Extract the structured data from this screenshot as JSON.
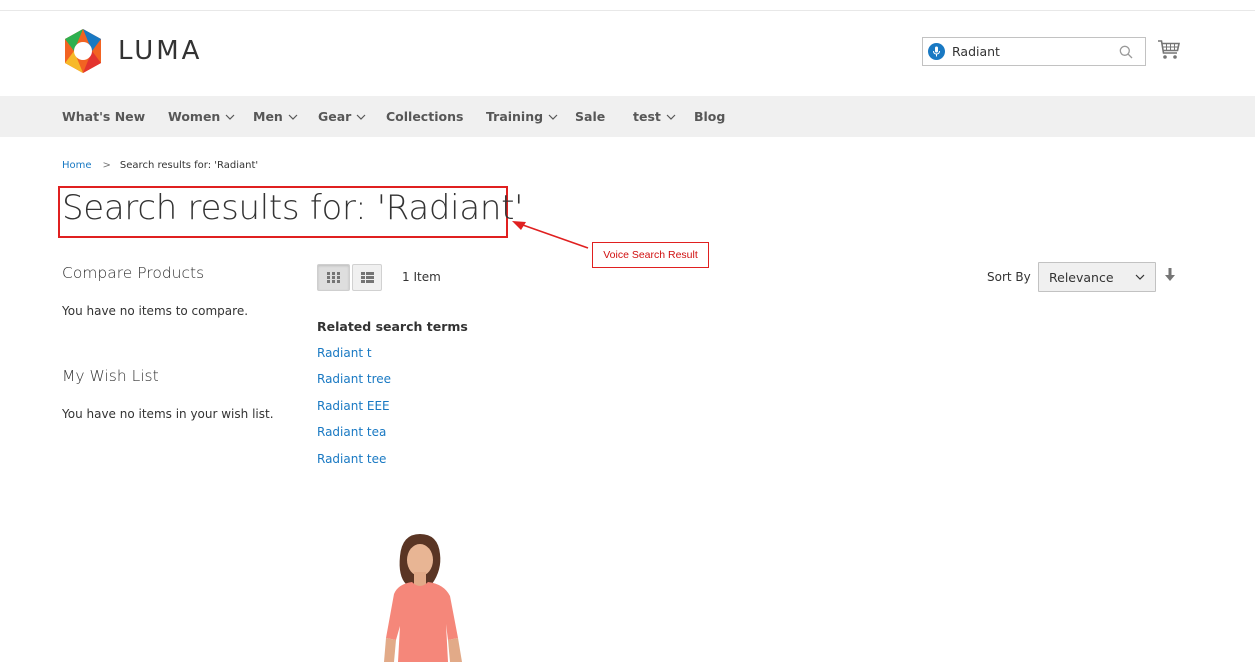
{
  "header": {
    "logo_text": "LUMA",
    "search_value": "Radiant",
    "colors": {
      "accent": "#1979c3",
      "annotation": "#e02020"
    }
  },
  "nav": {
    "items": [
      {
        "label": "What's New",
        "has_dropdown": false
      },
      {
        "label": "Women",
        "has_dropdown": true
      },
      {
        "label": "Men",
        "has_dropdown": true
      },
      {
        "label": "Gear",
        "has_dropdown": true
      },
      {
        "label": "Collections",
        "has_dropdown": false
      },
      {
        "label": "Training",
        "has_dropdown": true
      },
      {
        "label": "Sale",
        "has_dropdown": false
      },
      {
        "label": "test",
        "has_dropdown": true
      },
      {
        "label": "Blog",
        "has_dropdown": false
      }
    ]
  },
  "breadcrumb": {
    "home": "Home",
    "separator": ">",
    "current": "Search results for: 'Radiant'"
  },
  "page_title": "Search results for: 'Radiant'",
  "annotation": "Voice Search Result",
  "sidebar": {
    "compare_title": "Compare Products",
    "compare_empty": "You have no items to compare.",
    "wishlist_title": "My Wish List",
    "wishlist_empty": "You have no items in your wish list."
  },
  "toolbar": {
    "item_count": "1 Item",
    "sort_label": "Sort By",
    "sort_value": "Relevance"
  },
  "related": {
    "title": "Related search terms",
    "terms": [
      "Radiant t",
      "Radiant tree",
      "Radiant EEE",
      "Radiant tea",
      "Radiant tee"
    ]
  }
}
